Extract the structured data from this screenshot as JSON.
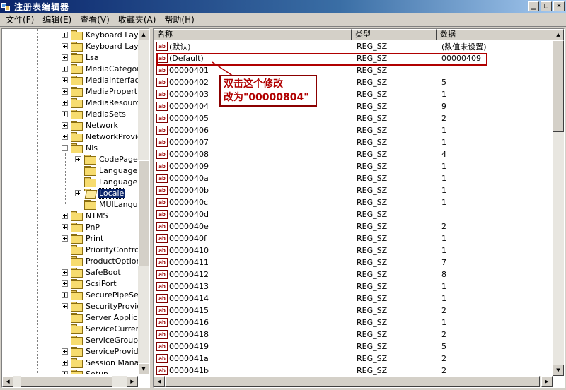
{
  "window": {
    "title": "注册表编辑器",
    "min": "_",
    "max": "□",
    "close": "×"
  },
  "menu": [
    "文件(F)",
    "编辑(E)",
    "查看(V)",
    "收藏夹(A)",
    "帮助(H)"
  ],
  "tree": [
    {
      "label": "Keyboard Layout",
      "level": 0,
      "exp": "plus"
    },
    {
      "label": "Keyboard Layouts",
      "level": 0,
      "exp": "plus"
    },
    {
      "label": "Lsa",
      "level": 0,
      "exp": "plus"
    },
    {
      "label": "MediaCategories",
      "level": 0,
      "exp": "plus"
    },
    {
      "label": "MediaInterfaces",
      "level": 0,
      "exp": "plus"
    },
    {
      "label": "MediaProperties",
      "level": 0,
      "exp": "plus"
    },
    {
      "label": "MediaResources",
      "level": 0,
      "exp": "plus"
    },
    {
      "label": "MediaSets",
      "level": 0,
      "exp": "plus"
    },
    {
      "label": "Network",
      "level": 0,
      "exp": "plus"
    },
    {
      "label": "NetworkProvider",
      "level": 0,
      "exp": "plus"
    },
    {
      "label": "Nls",
      "level": 0,
      "exp": "minus"
    },
    {
      "label": "CodePage",
      "level": 1,
      "exp": "plus"
    },
    {
      "label": "Language",
      "level": 1,
      "exp": "none"
    },
    {
      "label": "Language Groups",
      "level": 1,
      "exp": "none"
    },
    {
      "label": "Locale",
      "level": 1,
      "exp": "plus",
      "selected": true
    },
    {
      "label": "MUILanguages",
      "level": 1,
      "exp": "none"
    },
    {
      "label": "NTMS",
      "level": 0,
      "exp": "plus"
    },
    {
      "label": "PnP",
      "level": 0,
      "exp": "plus"
    },
    {
      "label": "Print",
      "level": 0,
      "exp": "plus"
    },
    {
      "label": "PriorityControl",
      "level": 0,
      "exp": "none"
    },
    {
      "label": "ProductOptions",
      "level": 0,
      "exp": "none"
    },
    {
      "label": "SafeBoot",
      "level": 0,
      "exp": "plus"
    },
    {
      "label": "ScsiPort",
      "level": 0,
      "exp": "plus"
    },
    {
      "label": "SecurePipeServers",
      "level": 0,
      "exp": "plus"
    },
    {
      "label": "SecurityProviders",
      "level": 0,
      "exp": "plus"
    },
    {
      "label": "Server Applications",
      "level": 0,
      "exp": "none"
    },
    {
      "label": "ServiceCurrent",
      "level": 0,
      "exp": "none"
    },
    {
      "label": "ServiceGroupOrder",
      "level": 0,
      "exp": "none"
    },
    {
      "label": "ServiceProvider",
      "level": 0,
      "exp": "plus"
    },
    {
      "label": "Session Manager",
      "level": 0,
      "exp": "plus"
    },
    {
      "label": "Setup",
      "level": 0,
      "exp": "plus"
    }
  ],
  "columns": {
    "name": "名称",
    "type": "类型",
    "data": "数据"
  },
  "values": [
    {
      "name": "(默认)",
      "type": "REG_SZ",
      "data": "(数值未设置)"
    },
    {
      "name": "(Default)",
      "type": "REG_SZ",
      "data": "00000409"
    },
    {
      "name": "00000401",
      "type": "REG_SZ",
      "data": ""
    },
    {
      "name": "00000402",
      "type": "REG_SZ",
      "data": "5"
    },
    {
      "name": "00000403",
      "type": "REG_SZ",
      "data": "1"
    },
    {
      "name": "00000404",
      "type": "REG_SZ",
      "data": "9"
    },
    {
      "name": "00000405",
      "type": "REG_SZ",
      "data": "2"
    },
    {
      "name": "00000406",
      "type": "REG_SZ",
      "data": "1"
    },
    {
      "name": "00000407",
      "type": "REG_SZ",
      "data": "1"
    },
    {
      "name": "00000408",
      "type": "REG_SZ",
      "data": "4"
    },
    {
      "name": "00000409",
      "type": "REG_SZ",
      "data": "1"
    },
    {
      "name": "0000040a",
      "type": "REG_SZ",
      "data": "1"
    },
    {
      "name": "0000040b",
      "type": "REG_SZ",
      "data": "1"
    },
    {
      "name": "0000040c",
      "type": "REG_SZ",
      "data": "1"
    },
    {
      "name": "0000040d",
      "type": "REG_SZ",
      "data": ""
    },
    {
      "name": "0000040e",
      "type": "REG_SZ",
      "data": "2"
    },
    {
      "name": "0000040f",
      "type": "REG_SZ",
      "data": "1"
    },
    {
      "name": "00000410",
      "type": "REG_SZ",
      "data": "1"
    },
    {
      "name": "00000411",
      "type": "REG_SZ",
      "data": "7"
    },
    {
      "name": "00000412",
      "type": "REG_SZ",
      "data": "8"
    },
    {
      "name": "00000413",
      "type": "REG_SZ",
      "data": "1"
    },
    {
      "name": "00000414",
      "type": "REG_SZ",
      "data": "1"
    },
    {
      "name": "00000415",
      "type": "REG_SZ",
      "data": "2"
    },
    {
      "name": "00000416",
      "type": "REG_SZ",
      "data": "1"
    },
    {
      "name": "00000418",
      "type": "REG_SZ",
      "data": "2"
    },
    {
      "name": "00000419",
      "type": "REG_SZ",
      "data": "5"
    },
    {
      "name": "0000041a",
      "type": "REG_SZ",
      "data": "2"
    },
    {
      "name": "0000041b",
      "type": "REG_SZ",
      "data": "2"
    }
  ],
  "annotation": {
    "line1": "双击这个修改",
    "line2": "改为\"00000804\""
  },
  "icons": {
    "value": "ab-icon",
    "key": "folder-icon"
  },
  "colors": {
    "highlight": "#b00000",
    "selection": "#0a246a"
  }
}
